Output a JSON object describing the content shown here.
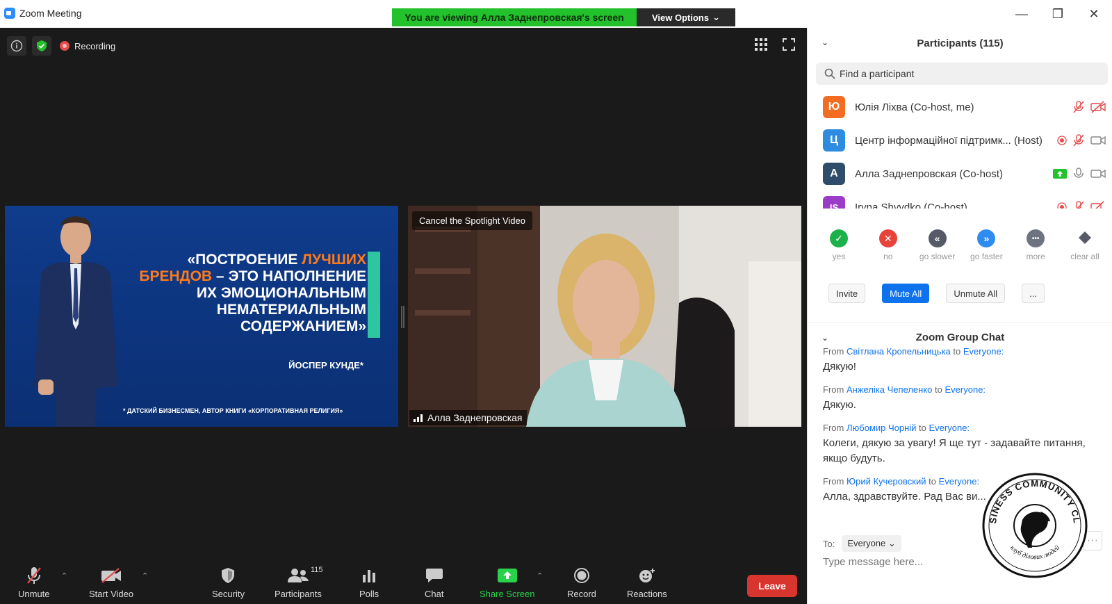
{
  "window": {
    "title": "Zoom Meeting",
    "view_banner": "You are viewing Алла Заднепровская's screen",
    "view_options_label": "View Options"
  },
  "meeting": {
    "recording_label": "Recording"
  },
  "slide": {
    "quote_before": "«Построение ",
    "quote_orange_1": "лучших",
    "quote_orange_2": "брендов",
    "quote_after": " – это наполнение их эмоциональным нематериальным содержанием»",
    "author": "ЙОСПЕР КУНДЕ*",
    "footnote": "* ДАТСКИЙ БИЗНЕСМЕН, АВТОР КНИГИ «КОРПОРАТИВНАЯ РЕЛИГИЯ»"
  },
  "camera": {
    "spotlight_label": "Cancel the Spotlight Video",
    "name": "Алла Заднепровская"
  },
  "toolbar": {
    "unmute": "Unmute",
    "start_video": "Start Video",
    "security": "Security",
    "participants": "Participants",
    "participants_count": "115",
    "polls": "Polls",
    "chat": "Chat",
    "share_screen": "Share Screen",
    "record": "Record",
    "reactions": "Reactions",
    "leave": "Leave"
  },
  "panel": {
    "participants_title": "Participants (115)",
    "search_placeholder": "Find a participant",
    "participants": [
      {
        "initial": "Ю",
        "color": "#f26d21",
        "name": "Юлія Ліхва (Co-host, me)"
      },
      {
        "initial": "Ц",
        "color": "#2e8ce0",
        "name": "Центр інформаційної підтримк...  (Host)"
      },
      {
        "initial": "А",
        "color": "#2f4d6a",
        "name": "Алла Заднепровская (Co-host)"
      },
      {
        "initial": "IS",
        "color": "#9b3cc9",
        "name": "Iryna Shvydko (Co-host)"
      }
    ],
    "reactions": [
      {
        "symbol": "✓",
        "label": "yes",
        "color": "#1cb14a"
      },
      {
        "symbol": "✕",
        "label": "no",
        "color": "#e8433a"
      },
      {
        "symbol": "«",
        "label": "go slower",
        "color": "#555a66"
      },
      {
        "symbol": "»",
        "label": "go faster",
        "color": "#2e8cf0"
      },
      {
        "symbol": "•••",
        "label": "more",
        "color": "#6e7380"
      },
      {
        "symbol": "",
        "label": "clear all",
        "color": "#555a66"
      }
    ],
    "invite": "Invite",
    "mute_all": "Mute All",
    "unmute_all": "Unmute All",
    "more_actions": "...",
    "chat_title": "Zoom Group Chat",
    "chat_messages": [
      {
        "from": "Світлана Кропельницька",
        "to": "Everyone:",
        "text": "Дякую!"
      },
      {
        "from": "Анжеліка Чепеленко",
        "to": "Everyone:",
        "text": "Дякую."
      },
      {
        "from": "Любомир Чорній",
        "to": "Everyone:",
        "text": "Колеги, дякую за увагу! Я ще тут - задавайте питання, якщо будуть."
      },
      {
        "from": "Юрий Кучеровский",
        "to": "Everyone:",
        "text": "Алла, здравствуйте. Рад Вас ви..."
      }
    ],
    "from_word": "From",
    "to_word": "to",
    "to_label": "To:",
    "to_value": "Everyone",
    "message_placeholder": "Type message here..."
  },
  "logo": {
    "top_text": "BUSINESS COMMUNITY CLUB",
    "bottom_text": "клуб ділових людей"
  }
}
